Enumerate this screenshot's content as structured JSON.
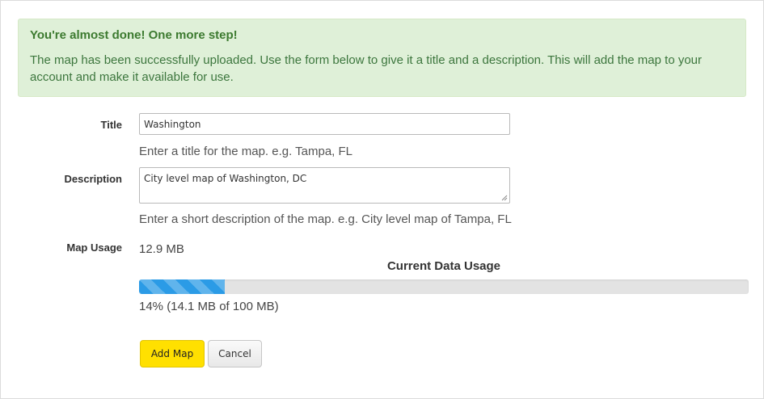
{
  "alert": {
    "title": "You're almost done! One more step!",
    "message": "The map has been successfully uploaded. Use the form below to give it a title and a description. This will add the map to your account and make it available for use."
  },
  "form": {
    "title_label": "Title",
    "title_value": "Washington",
    "title_help": "Enter a title for the map. e.g. Tampa, FL",
    "description_label": "Description",
    "description_value": "City level map of Washington, DC",
    "description_help": "Enter a short description of the map. e.g. City level map of Tampa, FL",
    "usage_label": "Map Usage",
    "usage_value": "12.9 MB"
  },
  "data_usage": {
    "title": "Current Data Usage",
    "percent": 14,
    "summary": "14% (14.1 MB of 100 MB)",
    "bar_color": "#2b9be6"
  },
  "buttons": {
    "add_label": "Add Map",
    "cancel_label": "Cancel"
  },
  "colors": {
    "alert_bg": "#dff0d8",
    "alert_text": "#3c763d",
    "add_button": "#ffe000"
  }
}
